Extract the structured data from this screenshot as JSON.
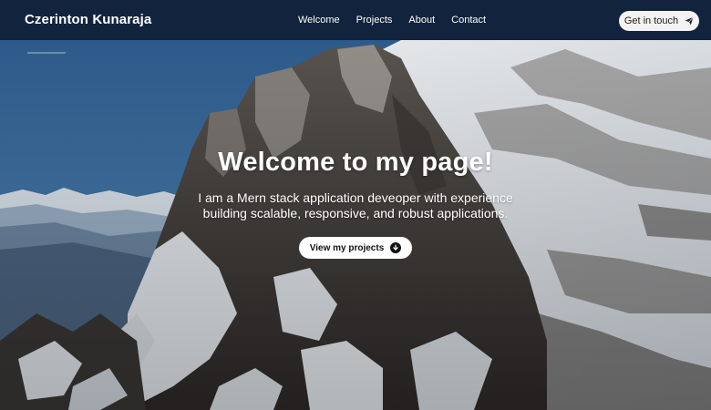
{
  "header": {
    "brand": "Czerinton Kunaraja",
    "nav": [
      {
        "label": "Welcome"
      },
      {
        "label": "Projects"
      },
      {
        "label": "About"
      },
      {
        "label": "Contact"
      }
    ],
    "cta_label": "Get in touch",
    "cta_icon": "paper-plane-icon"
  },
  "hero": {
    "title": "Welcome to my page!",
    "subtitle_line1": "I am a Mern stack application deveoper with experience",
    "subtitle_line2": "building scalable, responsive, and robust applications.",
    "button_label": "View my projects",
    "button_icon": "arrow-down-circle-icon",
    "background": "snowy-mountain-photo"
  },
  "colors": {
    "header_bg": "#11233d",
    "sky": "#3a6d9f",
    "button_bg": "#ffffff"
  }
}
